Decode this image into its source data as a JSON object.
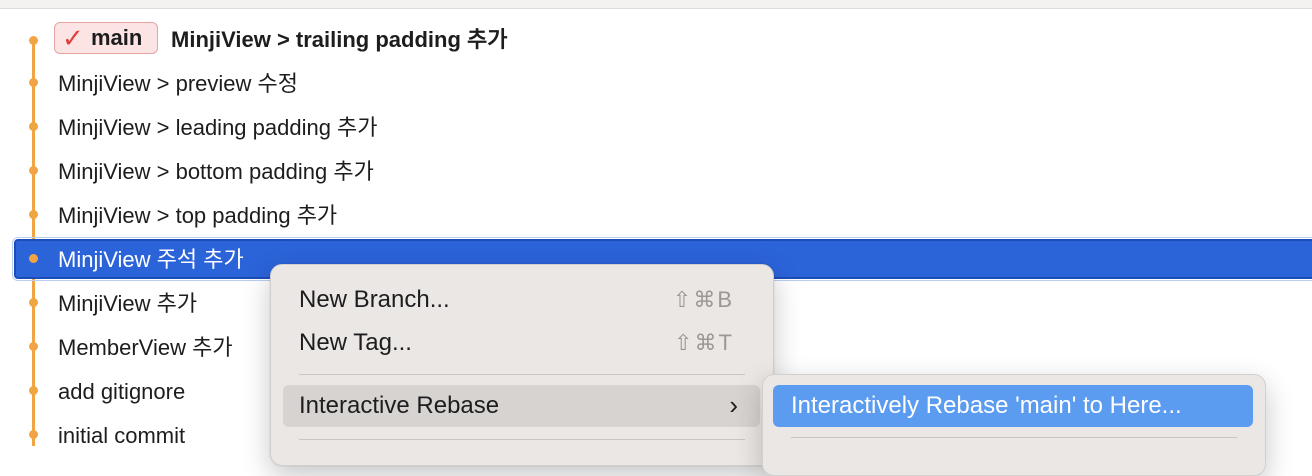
{
  "branch": {
    "name": "main"
  },
  "commits": [
    {
      "message": "MinjiView > trailing padding 추가"
    },
    {
      "message": "MinjiView > preview 수정"
    },
    {
      "message": "MinjiView > leading padding 추가"
    },
    {
      "message": "MinjiView > bottom padding 추가"
    },
    {
      "message": "MinjiView > top padding 추가"
    },
    {
      "message": "MinjiView 주석 추가"
    },
    {
      "message": "MinjiView 추가"
    },
    {
      "message": "MemberView 추가"
    },
    {
      "message": "add gitignore"
    },
    {
      "message": "initial commit"
    }
  ],
  "context_menu": {
    "items": [
      {
        "label": "New Branch...",
        "shortcut": "⇧⌘B"
      },
      {
        "label": "New Tag...",
        "shortcut": "⇧⌘T"
      },
      {
        "label": "Interactive Rebase",
        "submenu_icon": "chevron-right-icon"
      }
    ]
  },
  "submenu": {
    "items": [
      {
        "label": "Interactively Rebase 'main' to Here..."
      }
    ]
  },
  "colors": {
    "graph": "#f0a443",
    "selection": "#2b63d9",
    "submenu_highlight": "#5b9cf1",
    "branch_tag_bg": "#fbe4e3",
    "branch_tag_check": "#e0403e"
  }
}
